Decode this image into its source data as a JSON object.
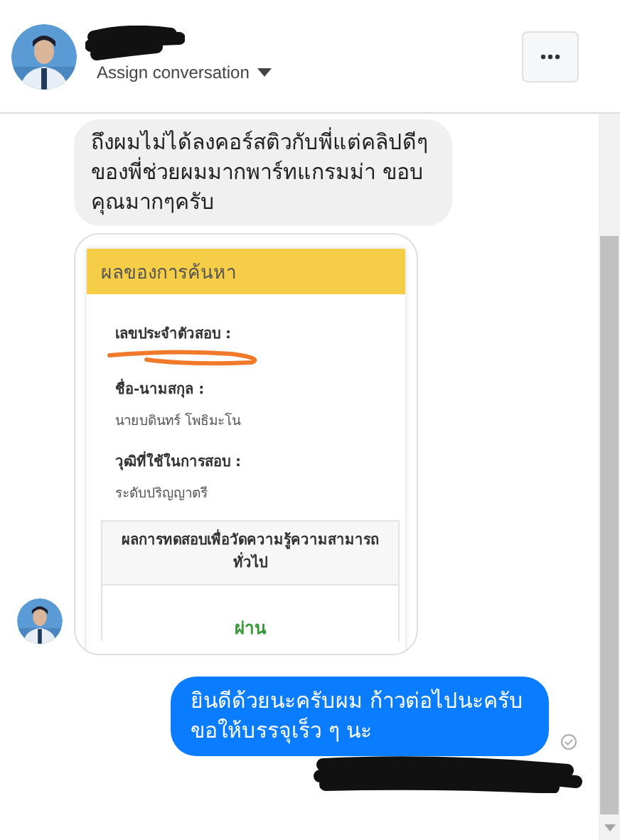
{
  "header": {
    "assign_label": "Assign conversation"
  },
  "messages": [
    {
      "kind": "incoming_text",
      "text": "ถึงผมไม่ได้ลงคอร์สติวกับพี่แต่คลิปดีๆของพี่ช่วยผมมากพาร์ทแกรมม่า ขอบคุณมากๆครับ"
    },
    {
      "kind": "incoming_image",
      "document": {
        "title": "ผลของการค้นหา",
        "fields": [
          {
            "label": "เลขประจำตัวสอบ :",
            "redacted": true
          },
          {
            "label": "ชื่อ-นามสกุล :",
            "value": "นายบดินทร์ โพธิมะโน"
          },
          {
            "label": "วุฒิที่ใช้ในการสอบ :",
            "value": "ระดับปริญญาตรี"
          }
        ],
        "result_header": "ผลการทดสอบเพื่อวัดความรู้ความสามารถทั่วไป",
        "result": "ผ่าน"
      }
    },
    {
      "kind": "outgoing_text",
      "text": "ยินดีด้วยนะครับผม ก้าวต่อไปนะครับ ขอให้บรรจุเร็ว ๆ นะ",
      "seen": true
    }
  ]
}
